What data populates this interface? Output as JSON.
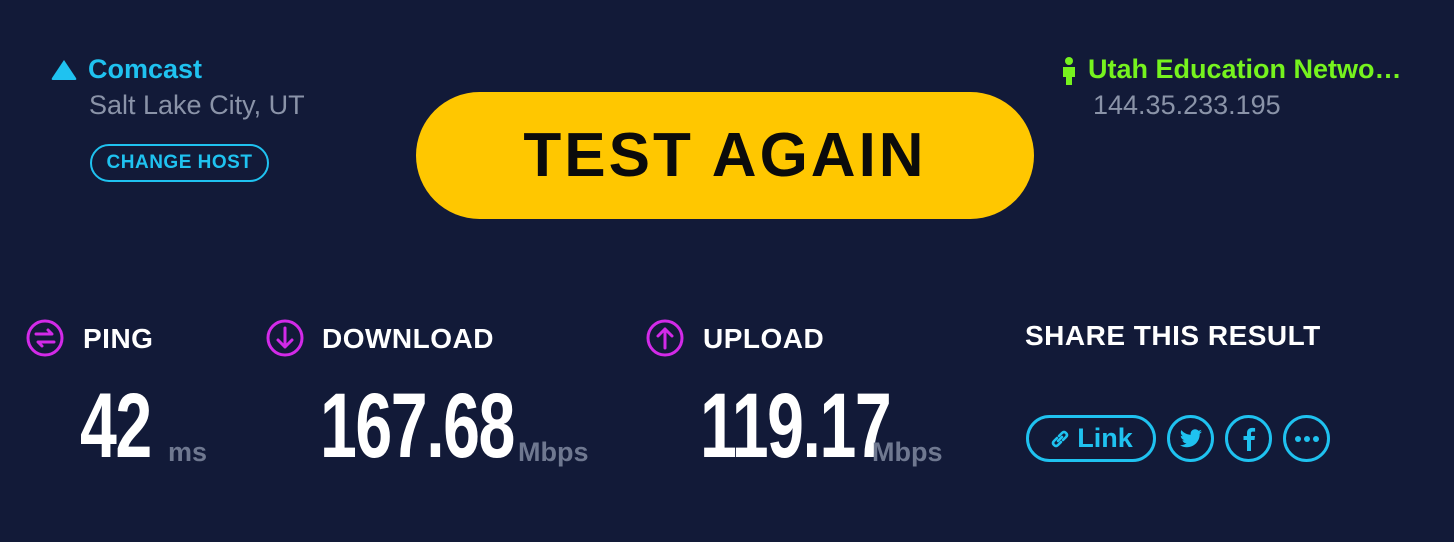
{
  "isp": {
    "name": "Comcast",
    "location": "Salt Lake City, UT",
    "change_host_label": "CHANGE HOST",
    "icon": "triangle-icon"
  },
  "server": {
    "name": "Utah Education Netwo…",
    "ip": "144.35.233.195",
    "icon": "person-icon"
  },
  "action": {
    "test_again_label": "TEST AGAIN"
  },
  "metrics": {
    "ping": {
      "label": "PING",
      "value": "42",
      "unit": "ms",
      "icon": "ping-icon"
    },
    "download": {
      "label": "DOWNLOAD",
      "value": "167.68",
      "unit": "Mbps",
      "icon": "download-arrow-icon"
    },
    "upload": {
      "label": "UPLOAD",
      "value": "119.17",
      "unit": "Mbps",
      "icon": "upload-arrow-icon"
    }
  },
  "share": {
    "title": "SHARE THIS RESULT",
    "link_label": "Link",
    "buttons": [
      "link-icon",
      "twitter-icon",
      "facebook-icon",
      "more-icon"
    ]
  },
  "colors": {
    "background": "#121a38",
    "accent_cyan": "#1fc2f0",
    "accent_yellow": "#ffc700",
    "accent_green": "#76f31e",
    "accent_magenta": "#d22ae8",
    "muted_text": "#8a93a8"
  }
}
